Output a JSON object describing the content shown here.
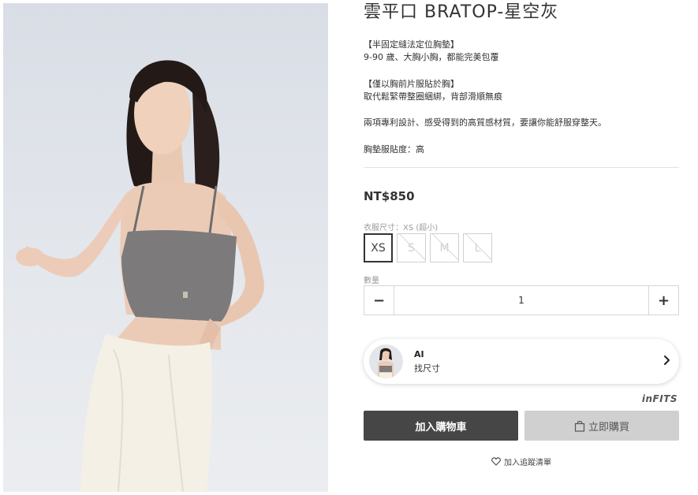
{
  "product": {
    "title": "雲平口 BRATOP-星空灰",
    "description": [
      "【半固定縫法定位胸墊】",
      "9-90 歲、大胸小胸，都能完美包覆",
      "【僅以胸前片服貼於胸】",
      "取代鬆緊帶整圈綑綁，背部滑順無痕",
      "兩項專利設計、感受得到的高質感材質，要讓你能舒服穿整天。",
      "胸墊服貼度：高"
    ],
    "price": "NT$850"
  },
  "size": {
    "label": "衣服尺寸：XS (超小)",
    "options": [
      "XS",
      "S",
      "M",
      "L"
    ],
    "selected": "XS"
  },
  "quantity": {
    "label": "數量",
    "minus": "−",
    "value": "1",
    "plus": "+"
  },
  "ai_card": {
    "title": "AI",
    "subtitle": "找尺寸"
  },
  "brand": "inFITS",
  "actions": {
    "add_to_cart": "加入購物車",
    "buy_now": "立即購買",
    "wishlist": "加入追蹤清單"
  },
  "colors": {
    "cart_button": "#464646",
    "buy_button": "#d0d0d0",
    "garment_gray": "#7c7a7a"
  }
}
